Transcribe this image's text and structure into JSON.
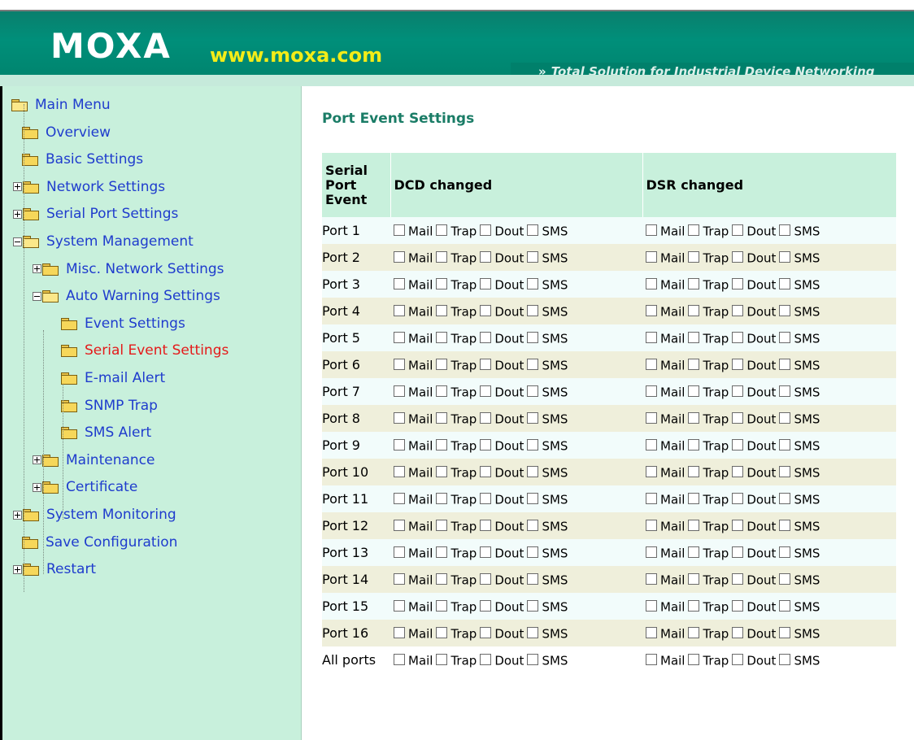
{
  "header": {
    "logo": "MOXA",
    "url": "www.moxa.com",
    "tagline_arrows": "»",
    "tagline": "Total Solution for Industrial Device Networking"
  },
  "sidebar": {
    "items": [
      {
        "label": "Main Menu",
        "icon": "folder-open-icon"
      },
      {
        "label": "Overview",
        "icon": "folder-icon"
      },
      {
        "label": "Basic Settings",
        "icon": "folder-icon"
      },
      {
        "label": "Network Settings",
        "icon": "folder-icon",
        "expander": "plus"
      },
      {
        "label": "Serial Port Settings",
        "icon": "folder-icon",
        "expander": "plus"
      },
      {
        "label": "System Management",
        "icon": "folder-open-icon",
        "expander": "minus"
      },
      {
        "label": "Misc. Network Settings",
        "icon": "folder-icon",
        "expander": "plus"
      },
      {
        "label": "Auto Warning Settings",
        "icon": "folder-open-icon",
        "expander": "minus"
      },
      {
        "label": "Event Settings",
        "icon": "folder-icon"
      },
      {
        "label": "Serial Event Settings",
        "icon": "folder-icon",
        "active": true
      },
      {
        "label": "E-mail Alert",
        "icon": "folder-icon"
      },
      {
        "label": "SNMP Trap",
        "icon": "folder-icon"
      },
      {
        "label": "SMS Alert",
        "icon": "folder-icon"
      },
      {
        "label": "Maintenance",
        "icon": "folder-icon",
        "expander": "plus"
      },
      {
        "label": "Certificate",
        "icon": "folder-icon",
        "expander": "plus"
      },
      {
        "label": "System Monitoring",
        "icon": "folder-icon",
        "expander": "plus"
      },
      {
        "label": "Save Configuration",
        "icon": "folder-icon"
      },
      {
        "label": "Restart",
        "icon": "folder-icon",
        "expander": "plus"
      }
    ]
  },
  "main": {
    "title": "Port Event Settings",
    "table": {
      "col_event": "Serial Port Event",
      "col_event_lines": [
        "Serial",
        "Port",
        "Event"
      ],
      "col_dcd": "DCD changed",
      "col_dsr": "DSR changed",
      "option_labels": [
        "Mail",
        "Trap",
        "Dout",
        "SMS"
      ],
      "rows": [
        "Port 1",
        "Port 2",
        "Port 3",
        "Port 4",
        "Port 5",
        "Port 6",
        "Port 7",
        "Port 8",
        "Port 9",
        "Port 10",
        "Port 11",
        "Port 12",
        "Port 13",
        "Port 14",
        "Port 15",
        "Port 16",
        "All ports"
      ]
    }
  },
  "colors": {
    "header_green": "#008f7a",
    "url_yellow": "#f3ec18",
    "sidebar_bg": "#c8f0dc",
    "link_blue": "#1f3ccd",
    "active_red": "#e41a1a",
    "title_green": "#1a7c66"
  }
}
